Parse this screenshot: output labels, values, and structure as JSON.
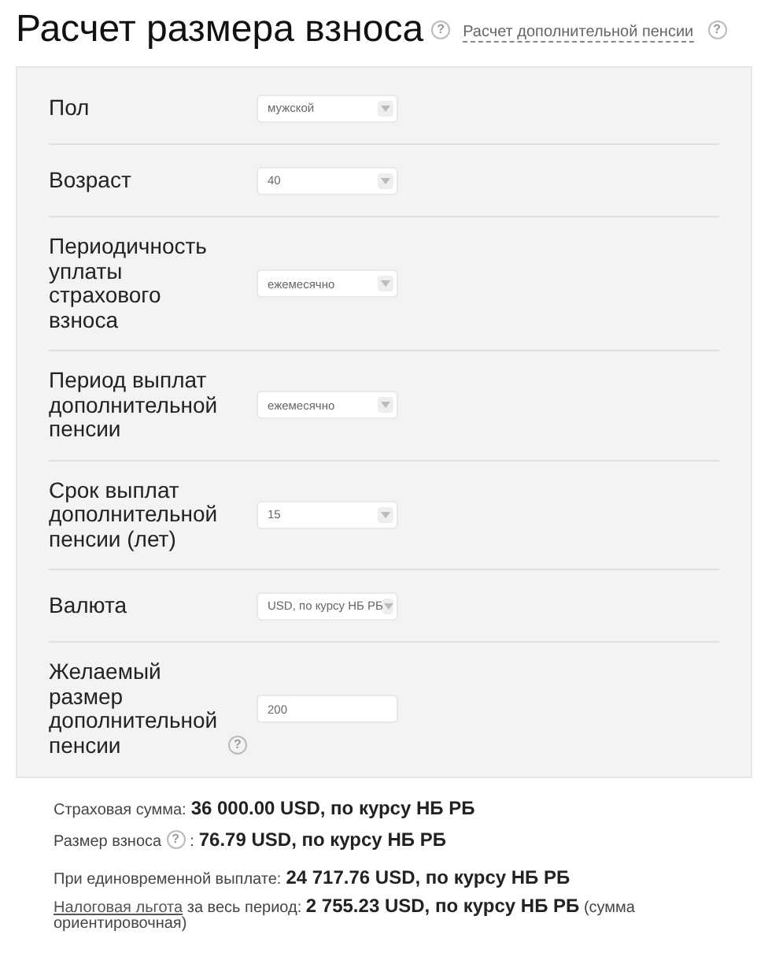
{
  "title": "Расчет размера взноса",
  "title_help": "?",
  "header_link": "Расчет дополнительной пенсии",
  "link_help": "?",
  "fields": [
    {
      "label": "Пол",
      "kind": "select",
      "value": "мужской"
    },
    {
      "label": "Возраст",
      "kind": "select",
      "value": "40"
    },
    {
      "label": "Периодичность уплаты страхового взноса",
      "kind": "select",
      "value": "ежемесячно"
    },
    {
      "label": "Период выплат дополнительной пенсии",
      "kind": "select",
      "value": "ежемесячно"
    },
    {
      "label": "Срок выплат дополнительной пенсии (лет)",
      "kind": "select",
      "value": "15"
    },
    {
      "label": "Валюта",
      "kind": "select",
      "value": "USD, по курсу НБ РБ"
    },
    {
      "label": "Желаемый размер дополнительной пенсии",
      "kind": "input",
      "value": "200",
      "help_icon": "?"
    }
  ],
  "results": [
    {
      "label": "Страховая сумма:",
      "value": "36 000.00 USD, по курсу НБ РБ"
    },
    {
      "label": "Размер взноса",
      "help_icon": "?",
      "suffix": ":",
      "value": "76.79 USD, по курсу НБ РБ"
    },
    {
      "label": "При единовременной выплате:",
      "value": "24 717.76 USD, по курсу НБ РБ"
    },
    {
      "link": "Налоговая льгота",
      "label": "за весь период:",
      "value": "2 755.23 USD, по курсу НБ РБ",
      "note": "(сумма ориентировочная)"
    }
  ]
}
